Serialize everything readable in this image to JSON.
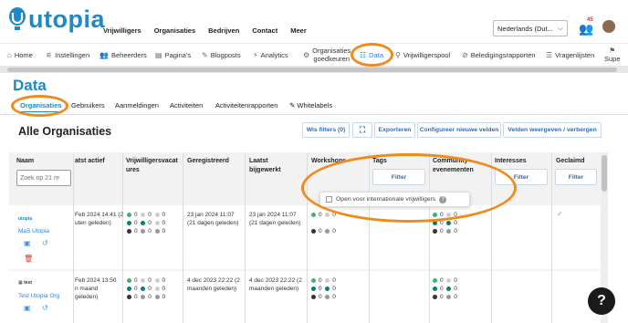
{
  "header": {
    "logo_text": "utopia",
    "nav": [
      "Vrijwilligers",
      "Organisaties",
      "Bedrijven",
      "Contact",
      "Meer"
    ],
    "language": "Nederlands (Dut...",
    "notification_count": "45"
  },
  "menu": [
    {
      "label": "Home",
      "icon": "home-icon"
    },
    {
      "label": "Instellingen",
      "icon": "sliders-icon"
    },
    {
      "label": "Beheerders",
      "icon": "users-icon"
    },
    {
      "label": "Pagina's",
      "icon": "pages-icon"
    },
    {
      "label": "Blogposts",
      "icon": "blog-icon"
    },
    {
      "label": "Analytics",
      "icon": "chart-icon"
    },
    {
      "label": "Organisaties goedkeuren",
      "icon": "approve-icon"
    },
    {
      "label": "Data",
      "icon": "data-icon"
    },
    {
      "label": "Vrijwilligerspool",
      "icon": "pool-icon"
    },
    {
      "label": "Beledigingsrapporten",
      "icon": "report-icon"
    },
    {
      "label": "Vragenlijsten",
      "icon": "list-icon"
    },
    {
      "label": "Supe",
      "icon": "super-icon"
    }
  ],
  "page_title": "Data",
  "subtabs": [
    "Organisaties",
    "Gebruikers",
    "Aanmeldingen",
    "Activiteiten",
    "Activiteitenrapporten",
    "Whitelabels"
  ],
  "section_title": "Alle Organisaties",
  "toolbar": {
    "clear_filters": "Wis filters (0)",
    "export": "Exporteren",
    "configure_fields": "Configureer nieuwe velden",
    "show_hide_fields": "Velden weergeven / verbergen"
  },
  "table": {
    "headers": [
      "Naam",
      "atst actief",
      "Vrijwilligersvacat\nures",
      "Geregistreerd",
      "Laatst\nbijgewerkt",
      "Workshops",
      "Tags",
      "Community\nevenementen",
      "Interesses",
      "Geclaimd"
    ],
    "search_placeholder": "Zoek op 21 re",
    "filter_label": "Filter",
    "rows": [
      {
        "name": "MaS Utopia",
        "last_active": "Feb 2024 14:41 (2\nuten geleden)",
        "registered": "23 jan 2024 11:07\n(21 dagen geleden)",
        "updated": "23 jan 2024 11:07\n(21 dagen geleden)",
        "vacancy_counts": [
          "0",
          "0",
          "0",
          "0",
          "0",
          "0",
          "0",
          "0",
          "0"
        ],
        "workshop_counts": [
          "0",
          "0",
          "0",
          "0"
        ],
        "community_counts": [
          "0",
          "0",
          "0",
          "0",
          "0",
          "0"
        ]
      },
      {
        "name": "Test Utopia Org",
        "last_active": "Feb 2024 13:50\nn maand\ngeleden)",
        "registered": "4 dec 2023 22:22 (2\nmaanden geleden)",
        "updated": "4 dec 2023 22:22 (2\nmaanden geleden)",
        "vacancy_counts": [
          "0",
          "0",
          "0",
          "0",
          "0",
          "0",
          "0",
          "0",
          "0"
        ],
        "workshop_counts": [
          "0",
          "0",
          "0",
          "0",
          "0",
          "0"
        ],
        "community_counts": [
          "0",
          "0",
          "0",
          "0",
          "0",
          "0"
        ]
      }
    ]
  },
  "popup": {
    "label": "Open voor internationale vrijwilligers"
  },
  "help_label": "?"
}
